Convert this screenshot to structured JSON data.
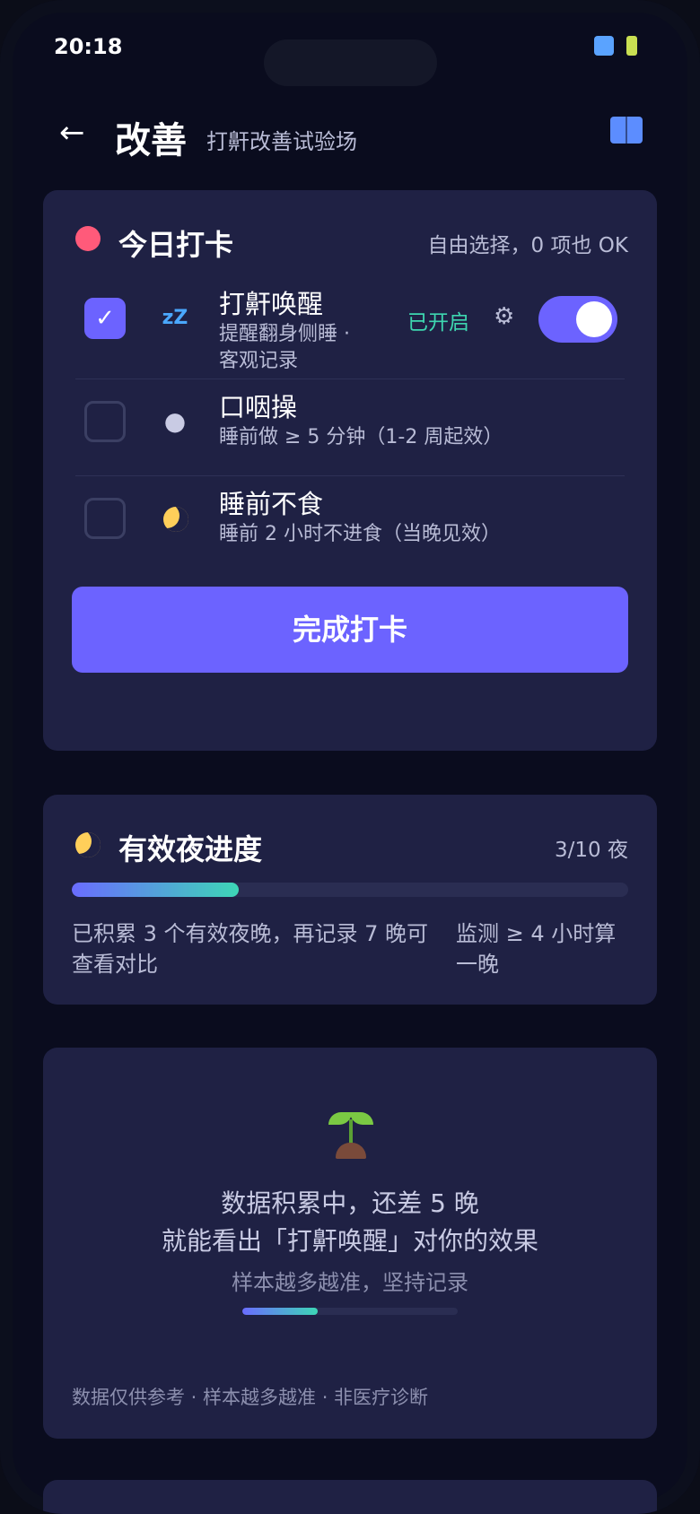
{
  "status": {
    "time": "20:18"
  },
  "header": {
    "back": "←",
    "title": "改善",
    "subtitle": "打鼾改善试验场"
  },
  "checkin": {
    "title": "今日打卡",
    "hint": "自由选择，0 项也 OK",
    "items": [
      {
        "title": "打鼾唤醒",
        "sub": "提醒翻身侧睡 · 客观记录",
        "checked": true,
        "state": "已开启",
        "icon": "sleep-zzz-icon"
      },
      {
        "title": "口咽操",
        "sub": "睡前做 ≥ 5 分钟（1-2 周起效）",
        "checked": false,
        "icon": "speaking-head-icon"
      },
      {
        "title": "睡前不食",
        "sub": "睡前 2 小时不进食（当晚见效）",
        "checked": false,
        "icon": "moon-icon"
      }
    ],
    "button": "完成打卡",
    "checkmark": "✓",
    "gear": "⚙"
  },
  "progress": {
    "title": "有效夜进度",
    "count": "3/10 夜",
    "value": 3,
    "total": 10,
    "note_left": "已积累 3 个有效夜晚，再记录 7 晚可查看对比",
    "note_right": "监测 ≥ 4 小时算一晚"
  },
  "analysis": {
    "line1": "数据积累中，还差 5 晚",
    "line2": "就能看出「打鼾唤醒」对你的效果",
    "line3": "样本越多越准，坚持记录",
    "mini_progress": 0.35,
    "footer": "数据仅供参考 · 样本越多越准 · 非医疗诊断"
  },
  "colors": {
    "accent": "#6c63ff",
    "enabled": "#3ed6b0",
    "card": "#1f2144",
    "bg": "#0a0c1e"
  }
}
